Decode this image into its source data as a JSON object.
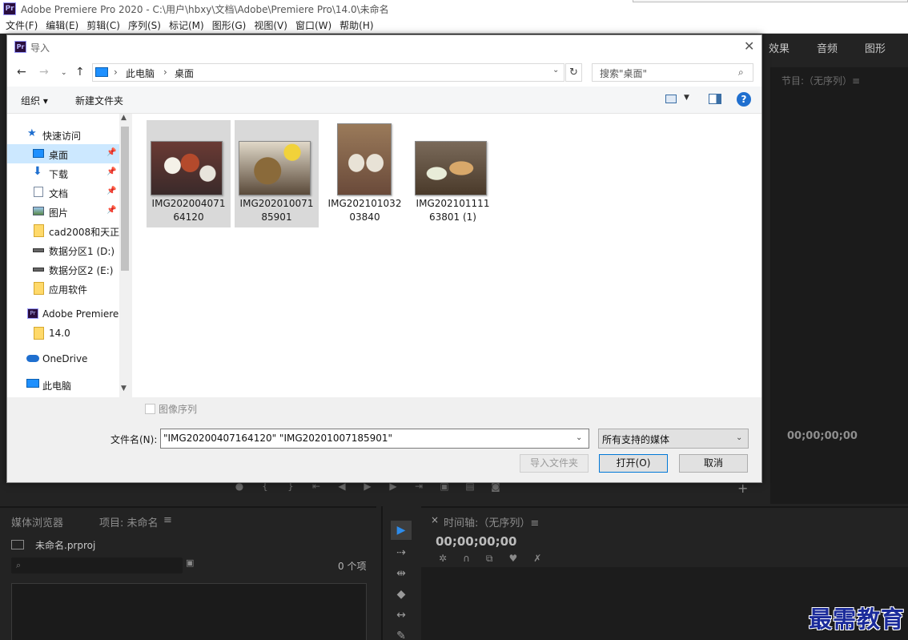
{
  "window": {
    "title": "Adobe Premiere Pro 2020 - C:\\用户\\hbxy\\文档\\Adobe\\Premiere Pro\\14.0\\未命名",
    "logo": "Pr"
  },
  "menu": [
    "文件(F)",
    "编辑(E)",
    "剪辑(C)",
    "序列(S)",
    "标记(M)",
    "图形(G)",
    "视图(V)",
    "窗口(W)",
    "帮助(H)"
  ],
  "workspace_tabs": [
    "效果",
    "音频",
    "图形"
  ],
  "program_monitor": {
    "title": "节目:（无序列）≡",
    "timecode": "00;00;00;00"
  },
  "project_panel": {
    "tab_media_browser": "媒体浏览器",
    "tab_project": "项目: 未命名",
    "tab_menu": "≡",
    "file_name": "未命名.prproj",
    "item_count": "0 个项"
  },
  "timeline": {
    "close": "×",
    "title": "时间轴:（无序列）≡",
    "timecode": "00;00;00;00"
  },
  "watermark": "最需教育",
  "dialog": {
    "logo": "Pr",
    "title": "导入",
    "close": "✕",
    "address": {
      "segments": [
        "此电脑",
        "桌面"
      ]
    },
    "search_placeholder": "搜索\"桌面\"",
    "organize": "组织 ▾",
    "new_folder": "新建文件夹",
    "help": "?",
    "nav_items": [
      {
        "label": "快速访问",
        "icon": "star-icon"
      },
      {
        "label": "桌面",
        "icon": "desktop-icon",
        "pinned": true
      },
      {
        "label": "下载",
        "icon": "download-icon",
        "pinned": true
      },
      {
        "label": "文档",
        "icon": "document-icon",
        "pinned": true
      },
      {
        "label": "图片",
        "icon": "picture-icon",
        "pinned": true
      },
      {
        "label": "cad2008和天正",
        "icon": "folder-icon"
      },
      {
        "label": "数据分区1 (D:)",
        "icon": "drive-icon"
      },
      {
        "label": "数据分区2 (E:)",
        "icon": "drive-icon"
      },
      {
        "label": "应用软件",
        "icon": "folder-icon"
      },
      {
        "label": "Adobe Premiere",
        "icon": "premiere-icon"
      },
      {
        "label": "14.0",
        "icon": "folder-icon"
      },
      {
        "label": "OneDrive",
        "icon": "cloud-icon"
      },
      {
        "label": "此电脑",
        "icon": "computer-icon"
      }
    ],
    "pin_glyph": "📌",
    "files": [
      {
        "name": "IMG20200407164120",
        "selected": true
      },
      {
        "name": "IMG20201007185901",
        "selected": true
      },
      {
        "name": "IMG20210103203840",
        "selected": false
      },
      {
        "name": "IMG20210111163801 (1)",
        "selected": false
      }
    ],
    "image_sequence_label": "图像序列",
    "filename_label": "文件名(N):",
    "filename_value": "\"IMG20200407164120\" \"IMG20201007185901\"",
    "filetype_value": "所有支持的媒体",
    "import_folder_button": "导入文件夹",
    "open_button": "打开(O)",
    "cancel_button": "取消"
  }
}
